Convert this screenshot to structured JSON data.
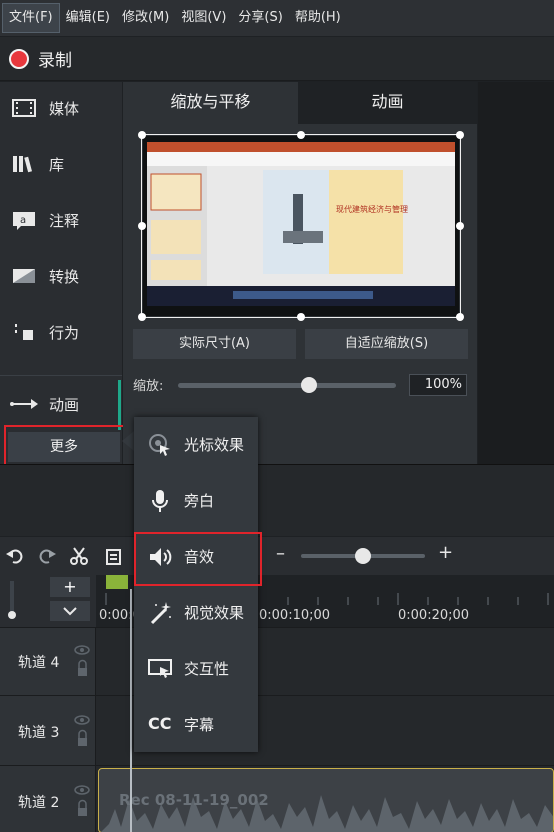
{
  "menubar": {
    "items": [
      "文件(F)",
      "编辑(E)",
      "修改(M)",
      "视图(V)",
      "分享(S)",
      "帮助(H)"
    ]
  },
  "record": {
    "label": "录制"
  },
  "sidebar": {
    "items": [
      "媒体",
      "库",
      "注释",
      "转换",
      "行为",
      "动画"
    ],
    "more": "更多"
  },
  "props": {
    "tabs": [
      "缩放与平移",
      "动画"
    ],
    "actual_size": "实际尺寸(A)",
    "fit_zoom": "自适应缩放(S)",
    "zoom_label": "缩放:",
    "zoom_value": "100%",
    "zoom_level": 0.6,
    "slide_title": "现代建筑经济与管理"
  },
  "timeline": {
    "timecodes": [
      "0:00:0",
      "0:00:10;00",
      "0:00:20;00"
    ],
    "tracks": [
      {
        "name": "轨道 4"
      },
      {
        "name": "轨道 3"
      },
      {
        "name": "轨道 2",
        "clip": "Rec 08-11-19_002"
      }
    ]
  },
  "popup": {
    "items": [
      {
        "label": "光标效果",
        "icon": "cursor-effect-icon"
      },
      {
        "label": "旁白",
        "icon": "microphone-icon"
      },
      {
        "label": "音效",
        "icon": "speaker-icon"
      },
      {
        "label": "视觉效果",
        "icon": "magic-wand-icon"
      },
      {
        "label": "交互性",
        "icon": "interactive-icon"
      },
      {
        "label": "字幕",
        "icon": "cc-icon"
      }
    ]
  },
  "colors": {
    "highlight": "#e0242b",
    "record": "#e8383d",
    "slide_accent": "#c0502d"
  }
}
